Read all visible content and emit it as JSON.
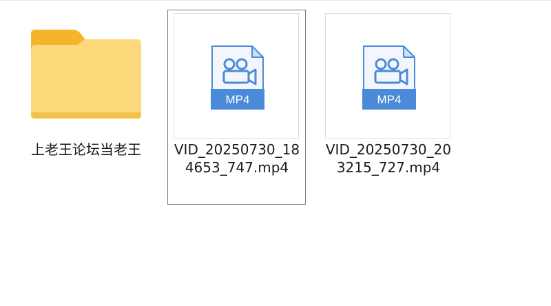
{
  "files": [
    {
      "name": "上老王论坛当老王",
      "type": "folder",
      "icon": "folder-icon",
      "selected": false
    },
    {
      "name": "VID_20250730_184653_747.mp4",
      "type": "video",
      "icon": "mp4-file-icon",
      "badge": "MP4",
      "selected": true
    },
    {
      "name": "VID_20250730_203215_727.mp4",
      "type": "video",
      "icon": "mp4-file-icon",
      "badge": "MP4",
      "selected": false
    }
  ],
  "colors": {
    "folder_front": "#fcd97a",
    "folder_back": "#f5b52a",
    "mp4_blue": "#4a8ad8",
    "mp4_page": "#f3f7fd",
    "selection_border": "#7a7a7a"
  }
}
